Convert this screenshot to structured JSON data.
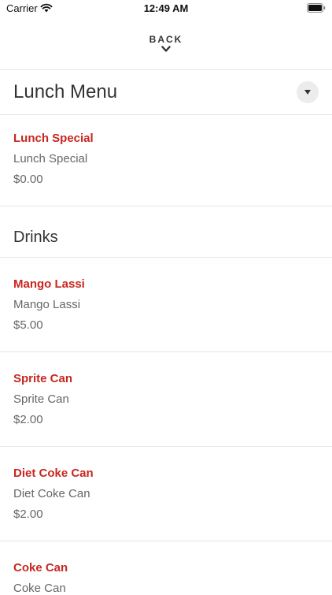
{
  "status_bar": {
    "carrier": "Carrier",
    "time": "12:49 AM"
  },
  "header": {
    "back_label": "BACK"
  },
  "menu": {
    "title": "Lunch Menu"
  },
  "lunch_items": [
    {
      "name": "Lunch Special",
      "description": "Lunch Special",
      "price": "$0.00"
    }
  ],
  "drinks": {
    "title": "Drinks",
    "items": [
      {
        "name": "Mango Lassi",
        "description": "Mango Lassi",
        "price": "$5.00"
      },
      {
        "name": "Sprite Can",
        "description": "Sprite Can",
        "price": "$2.00"
      },
      {
        "name": "Diet Coke Can",
        "description": "Diet Coke Can",
        "price": "$2.00"
      },
      {
        "name": "Coke Can",
        "description": "Coke Can",
        "price": ""
      }
    ]
  },
  "colors": {
    "item_name": "#c8271f",
    "divider": "#e6e6e6",
    "dropdown_bg": "#ececec"
  },
  "icons": [
    "wifi-icon",
    "battery-icon",
    "chevron-down-icon",
    "caret-down-icon"
  ]
}
